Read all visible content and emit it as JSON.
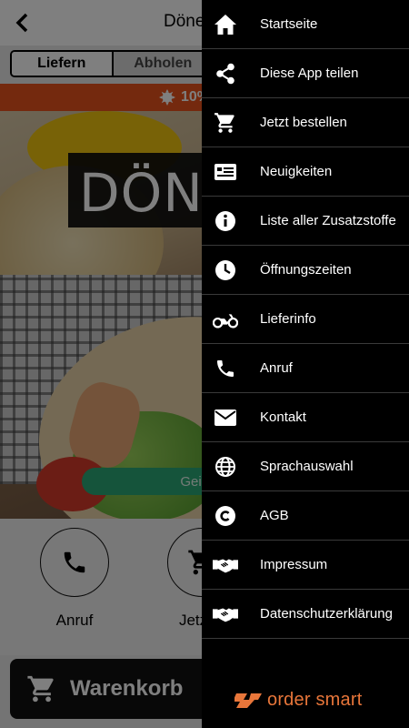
{
  "topbar": {
    "title": "Döne"
  },
  "mode_toggle": {
    "deliver_label": "Liefern",
    "pickup_label": "Abholen"
  },
  "promo": {
    "text": "10%"
  },
  "hero": {
    "title": "DÖNER",
    "open_button_label": "Gei"
  },
  "quick_actions": [
    {
      "label": "Anruf",
      "icon": "phone-icon"
    },
    {
      "label": "Jetzt b",
      "icon": "cart-icon"
    }
  ],
  "cart": {
    "label": "Warenkorb",
    "icon": "cart-icon"
  },
  "drawer": {
    "items": [
      {
        "label": "Startseite",
        "icon": "home-icon"
      },
      {
        "label": "Diese App teilen",
        "icon": "share-icon"
      },
      {
        "label": "Jetzt bestellen",
        "icon": "cart-icon"
      },
      {
        "label": "Neuigkeiten",
        "icon": "news-icon"
      },
      {
        "label": "Liste aller Zusatzstoffe",
        "icon": "info-icon"
      },
      {
        "label": "Öffnungszeiten",
        "icon": "clock-icon"
      },
      {
        "label": "Lieferinfo",
        "icon": "motorbike-icon"
      },
      {
        "label": "Anruf",
        "icon": "phone-icon"
      },
      {
        "label": "Kontakt",
        "icon": "mail-icon"
      },
      {
        "label": "Sprachauswahl",
        "icon": "globe-icon"
      },
      {
        "label": "AGB",
        "icon": "copyright-icon"
      },
      {
        "label": "Impressum",
        "icon": "handshake-icon"
      },
      {
        "label": "Datenschutzerklärung",
        "icon": "handshake-icon"
      }
    ],
    "brand": "order smart"
  },
  "colors": {
    "accent": "#e8531d",
    "brand_orange": "#e8763a",
    "open_green": "#2aa876",
    "drawer_bg": "#000000"
  }
}
